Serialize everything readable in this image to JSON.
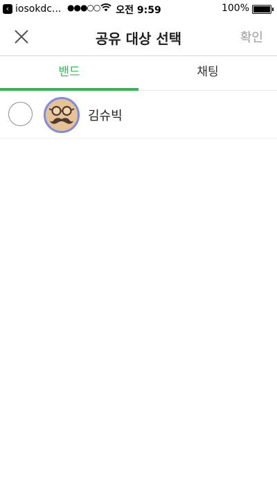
{
  "status_bar": {
    "back_app": "iosokdc...",
    "signal": "●●●○○",
    "time": "오전 9:59",
    "battery": "100%"
  },
  "header": {
    "title": "공유 대상 선택",
    "confirm_label": "확인"
  },
  "tabs": [
    {
      "label": "밴드",
      "active": true
    },
    {
      "label": "채팅",
      "active": false
    }
  ],
  "list": [
    {
      "name": "김슈빅",
      "selected": false
    }
  ],
  "colors": {
    "accent": "#2dbd4e",
    "avatar_border": "#7b8be6",
    "avatar_bg": "#e7c294"
  }
}
